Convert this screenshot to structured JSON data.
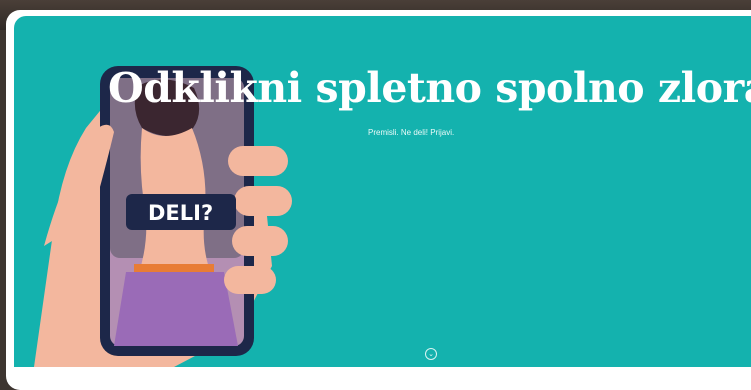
{
  "hero": {
    "title": "Odklikni spletno spolno zlorabo",
    "subtitle": "Premisli. Ne deli! Prijavi.",
    "badge_text": "DELI?"
  },
  "scroll_button": {
    "icon": "chevron-down-icon",
    "glyph": "⌄"
  },
  "colors": {
    "hero_background": "#14b2ae",
    "phone": "#1d2749",
    "skin": "#f3b79e",
    "badge": "#1d2749"
  }
}
